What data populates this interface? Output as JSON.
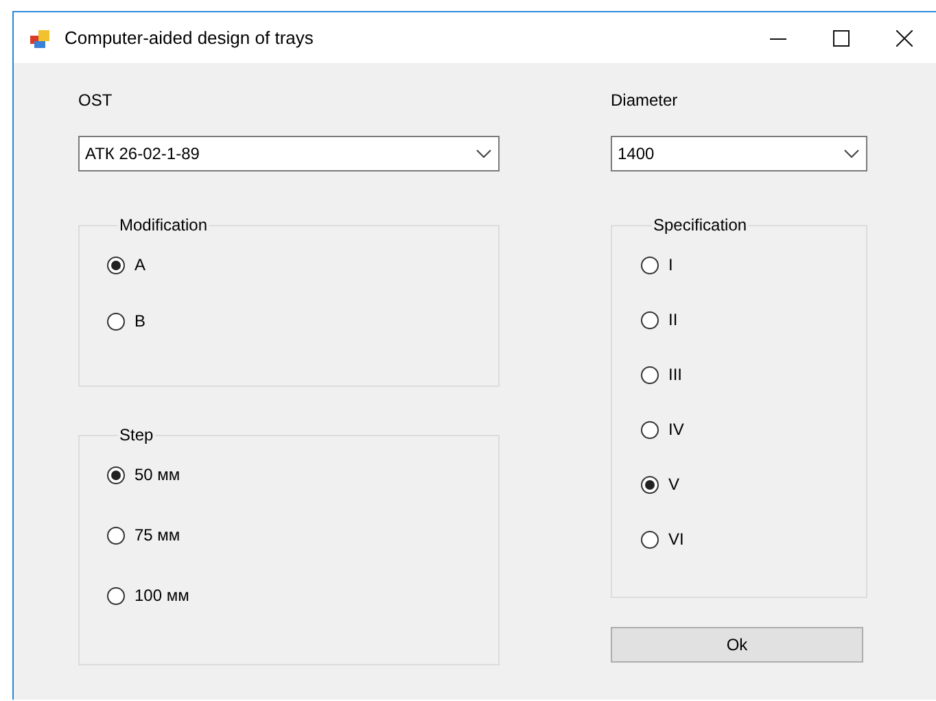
{
  "window": {
    "title": "Computer-aided design of trays"
  },
  "ost": {
    "label": "OST",
    "value": "АТК 26-02-1-89"
  },
  "diameter": {
    "label": "Diameter",
    "value": "1400"
  },
  "groups": [
    {
      "title": "Modification",
      "options": [
        {
          "label": "A",
          "selected": true
        },
        {
          "label": "B",
          "selected": false
        }
      ]
    },
    {
      "title": "Step",
      "options": [
        {
          "label": "50 мм",
          "selected": true
        },
        {
          "label": "75 мм",
          "selected": false
        },
        {
          "label": "100 мм",
          "selected": false
        }
      ]
    },
    {
      "title": "Specification",
      "options": [
        {
          "label": "I",
          "selected": false
        },
        {
          "label": "II",
          "selected": false
        },
        {
          "label": "III",
          "selected": false
        },
        {
          "label": "IV",
          "selected": false
        },
        {
          "label": "V",
          "selected": true
        },
        {
          "label": "VI",
          "selected": false
        }
      ]
    }
  ],
  "ok_button": "Ok"
}
